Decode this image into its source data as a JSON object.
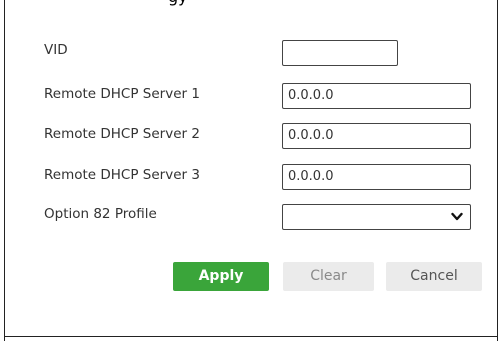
{
  "form": {
    "top_fragment": "gy",
    "vid": {
      "label": "VID",
      "value": ""
    },
    "remote_server_1": {
      "label": "Remote DHCP Server 1",
      "value": "0.0.0.0"
    },
    "remote_server_2": {
      "label": "Remote DHCP Server 2",
      "value": "0.0.0.0"
    },
    "remote_server_3": {
      "label": "Remote DHCP Server 3",
      "value": "0.0.0.0"
    },
    "option82": {
      "label": "Option 82 Profile",
      "selected": ""
    }
  },
  "buttons": {
    "apply": "Apply",
    "clear": "Clear",
    "cancel": "Cancel"
  },
  "colors": {
    "apply_bg": "#3aa53a",
    "secondary_bg": "#ebebeb"
  },
  "icons": {
    "dropdown": "chevron-down-icon"
  }
}
